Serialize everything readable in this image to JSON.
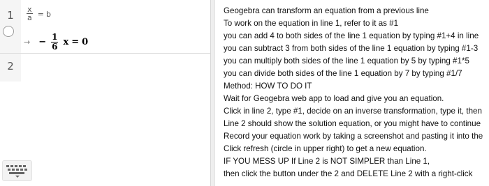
{
  "algebra": {
    "rows": [
      {
        "number": "1",
        "definition": {
          "numerator": "x",
          "denominator": "a",
          "equals": "=",
          "rhs": "b"
        },
        "output": {
          "arrow": "→",
          "minus": "−",
          "numerator": "1",
          "denominator": "6",
          "variable": "x",
          "equals": "=",
          "rhs": "0"
        }
      },
      {
        "number": "2"
      }
    ],
    "icons": {
      "visibility_toggle": "circle-icon",
      "keyboard": "keyboard-icon"
    }
  },
  "text_panel": {
    "lines": [
      "Geogebra can transform an equation from a previous line",
      "To work on the equation in line 1, refer to it as #1",
      "you can add 4 to both sides of the line 1 equation by typing #1+4 in line",
      "you can subtract 3 from both sides of the line 1 equation by typing #1-3",
      "you can multiply both sides of the line 1 equation by 5 by typing #1*5",
      "you can divide both sides of the line 1 equation by 7 by typing #1/7",
      "Method: HOW TO DO IT",
      "Wait for Geogebra web app to load and give you an equation.",
      "Click in line 2, type #1, decide on an inverse transformation, type it, then",
      "Line 2 should show the solution equation, or you might have to continue",
      "Record your equation work by taking a screenshot and pasting it into the",
      "Click refresh (circle in upper right) to get a new equation.",
      "IF YOU MESS UP If Line 2 is NOT SIMPLER than Line 1,",
      "then click the button under the 2 and DELETE Line 2 with a right-click"
    ]
  },
  "colors": {
    "gutter": "#f5f5f5",
    "divider": "#dcdcdc",
    "text": "#111111",
    "muted": "#555555"
  }
}
